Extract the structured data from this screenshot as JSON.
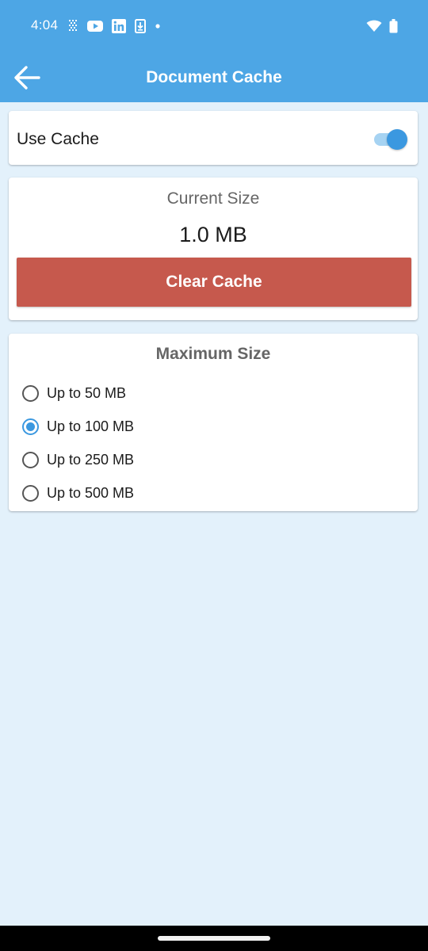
{
  "status_bar": {
    "time": "4:04",
    "left_icons": [
      "signal-grid-icon",
      "youtube-icon",
      "linkedin-icon",
      "download-icon",
      "dot-icon"
    ],
    "right_icons": [
      "wifi-icon",
      "battery-icon"
    ]
  },
  "app_bar": {
    "title": "Document Cache",
    "back_icon": "arrow-left-icon"
  },
  "use_cache": {
    "label": "Use Cache",
    "enabled": true
  },
  "current_size": {
    "label": "Current Size",
    "value": "1.0 MB",
    "clear_label": "Clear Cache"
  },
  "max_size": {
    "title": "Maximum Size",
    "options": [
      {
        "label": "Up to 50 MB",
        "selected": false
      },
      {
        "label": "Up to 100 MB",
        "selected": true
      },
      {
        "label": "Up to 250 MB",
        "selected": false
      },
      {
        "label": "Up to 500 MB",
        "selected": false
      }
    ]
  },
  "colors": {
    "accent": "#4da6e5",
    "toggle": "#3b98e0",
    "clear_button": "#c6594d",
    "background": "#e3f1fb"
  }
}
